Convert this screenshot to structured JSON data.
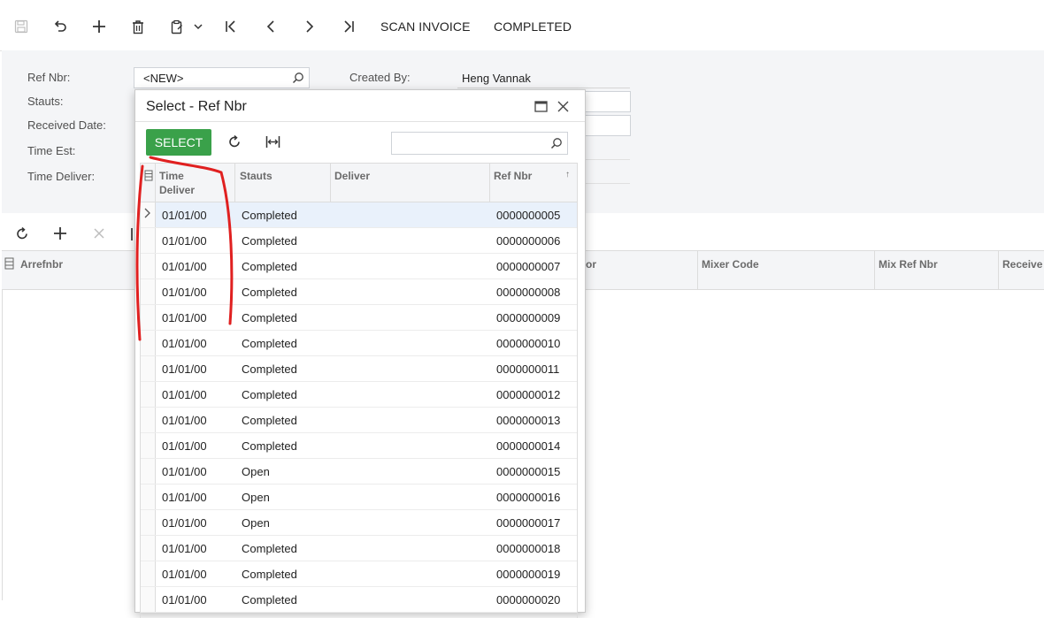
{
  "toolbar": {
    "scan_invoice_label": "SCAN INVOICE",
    "completed_label": "COMPLETED"
  },
  "form": {
    "ref_nbr_label": "Ref Nbr:",
    "ref_nbr_value": "<NEW>",
    "status_label": "Stauts:",
    "received_date_label": "Received Date:",
    "time_est_label": "Time Est:",
    "time_deliver_label": "Time Deliver:",
    "created_by_label": "Created By:",
    "created_by_value": "Heng Vannak"
  },
  "grid": {
    "columns": [
      "Arrefnbr",
      "or",
      "Mixer Code",
      "Mix Ref Nbr",
      "Receive"
    ]
  },
  "dialog": {
    "title": "Select - Ref Nbr",
    "select_label": "SELECT",
    "search_placeholder": "",
    "columns": {
      "time_deliver_line1": "Time",
      "time_deliver_line2": "Deliver",
      "status": "Stauts",
      "deliver": "Deliver",
      "ref_nbr": "Ref Nbr",
      "sort_indicator": "↑"
    },
    "rows": [
      {
        "time": "01/01/00",
        "status": "Completed",
        "deliver": "",
        "ref": "0000000005"
      },
      {
        "time": "01/01/00",
        "status": "Completed",
        "deliver": "",
        "ref": "0000000006"
      },
      {
        "time": "01/01/00",
        "status": "Completed",
        "deliver": "",
        "ref": "0000000007"
      },
      {
        "time": "01/01/00",
        "status": "Completed",
        "deliver": "",
        "ref": "0000000008"
      },
      {
        "time": "01/01/00",
        "status": "Completed",
        "deliver": "",
        "ref": "0000000009"
      },
      {
        "time": "01/01/00",
        "status": "Completed",
        "deliver": "",
        "ref": "0000000010"
      },
      {
        "time": "01/01/00",
        "status": "Completed",
        "deliver": "",
        "ref": "0000000011"
      },
      {
        "time": "01/01/00",
        "status": "Completed",
        "deliver": "",
        "ref": "0000000012"
      },
      {
        "time": "01/01/00",
        "status": "Completed",
        "deliver": "",
        "ref": "0000000013"
      },
      {
        "time": "01/01/00",
        "status": "Completed",
        "deliver": "",
        "ref": "0000000014"
      },
      {
        "time": "01/01/00",
        "status": "Open",
        "deliver": "",
        "ref": "0000000015"
      },
      {
        "time": "01/01/00",
        "status": "Open",
        "deliver": "",
        "ref": "0000000016"
      },
      {
        "time": "01/01/00",
        "status": "Open",
        "deliver": "",
        "ref": "0000000017"
      },
      {
        "time": "01/01/00",
        "status": "Completed",
        "deliver": "",
        "ref": "0000000018"
      },
      {
        "time": "01/01/00",
        "status": "Completed",
        "deliver": "",
        "ref": "0000000019"
      },
      {
        "time": "01/01/00",
        "status": "Completed",
        "deliver": "",
        "ref": "0000000020"
      }
    ]
  },
  "icons": {
    "save": "save-icon",
    "undo": "undo-icon",
    "add": "plus-icon",
    "delete": "trash-icon",
    "copy": "clipboard-icon",
    "first": "first-page-icon",
    "prev": "chevron-left-icon",
    "next": "chevron-right-icon",
    "last": "last-page-icon",
    "refresh": "refresh-icon",
    "fit": "fit-columns-icon",
    "search": "search-icon",
    "maximize": "maximize-icon",
    "close": "close-icon"
  },
  "colors": {
    "accent_green": "#3aa14a",
    "annotation_red": "#e02020",
    "selected_row": "#e9f1fb"
  }
}
